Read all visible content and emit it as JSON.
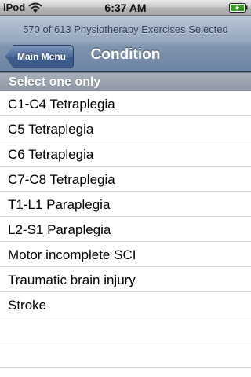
{
  "status_bar": {
    "carrier": "iPod",
    "time": "6:37 AM"
  },
  "nav_bar": {
    "prompt": "570 of 613 Physiotherapy Exercises Selected",
    "back_label": "Main Menu",
    "title": "Condition"
  },
  "section": {
    "header": "Select one only"
  },
  "conditions": [
    "C1-C4 Tetraplegia",
    "C5 Tetraplegia",
    "C6 Tetraplegia",
    "C7-C8 Tetraplegia",
    "T1-L1 Paraplegia",
    "L2-S1 Paraplegia",
    "Motor incomplete SCI",
    "Traumatic brain injury",
    "Stroke",
    "",
    ""
  ],
  "colors": {
    "nav_bar": "#8ea1b9",
    "back_button": "#4c6a98",
    "section_header": "#98a2ad"
  }
}
